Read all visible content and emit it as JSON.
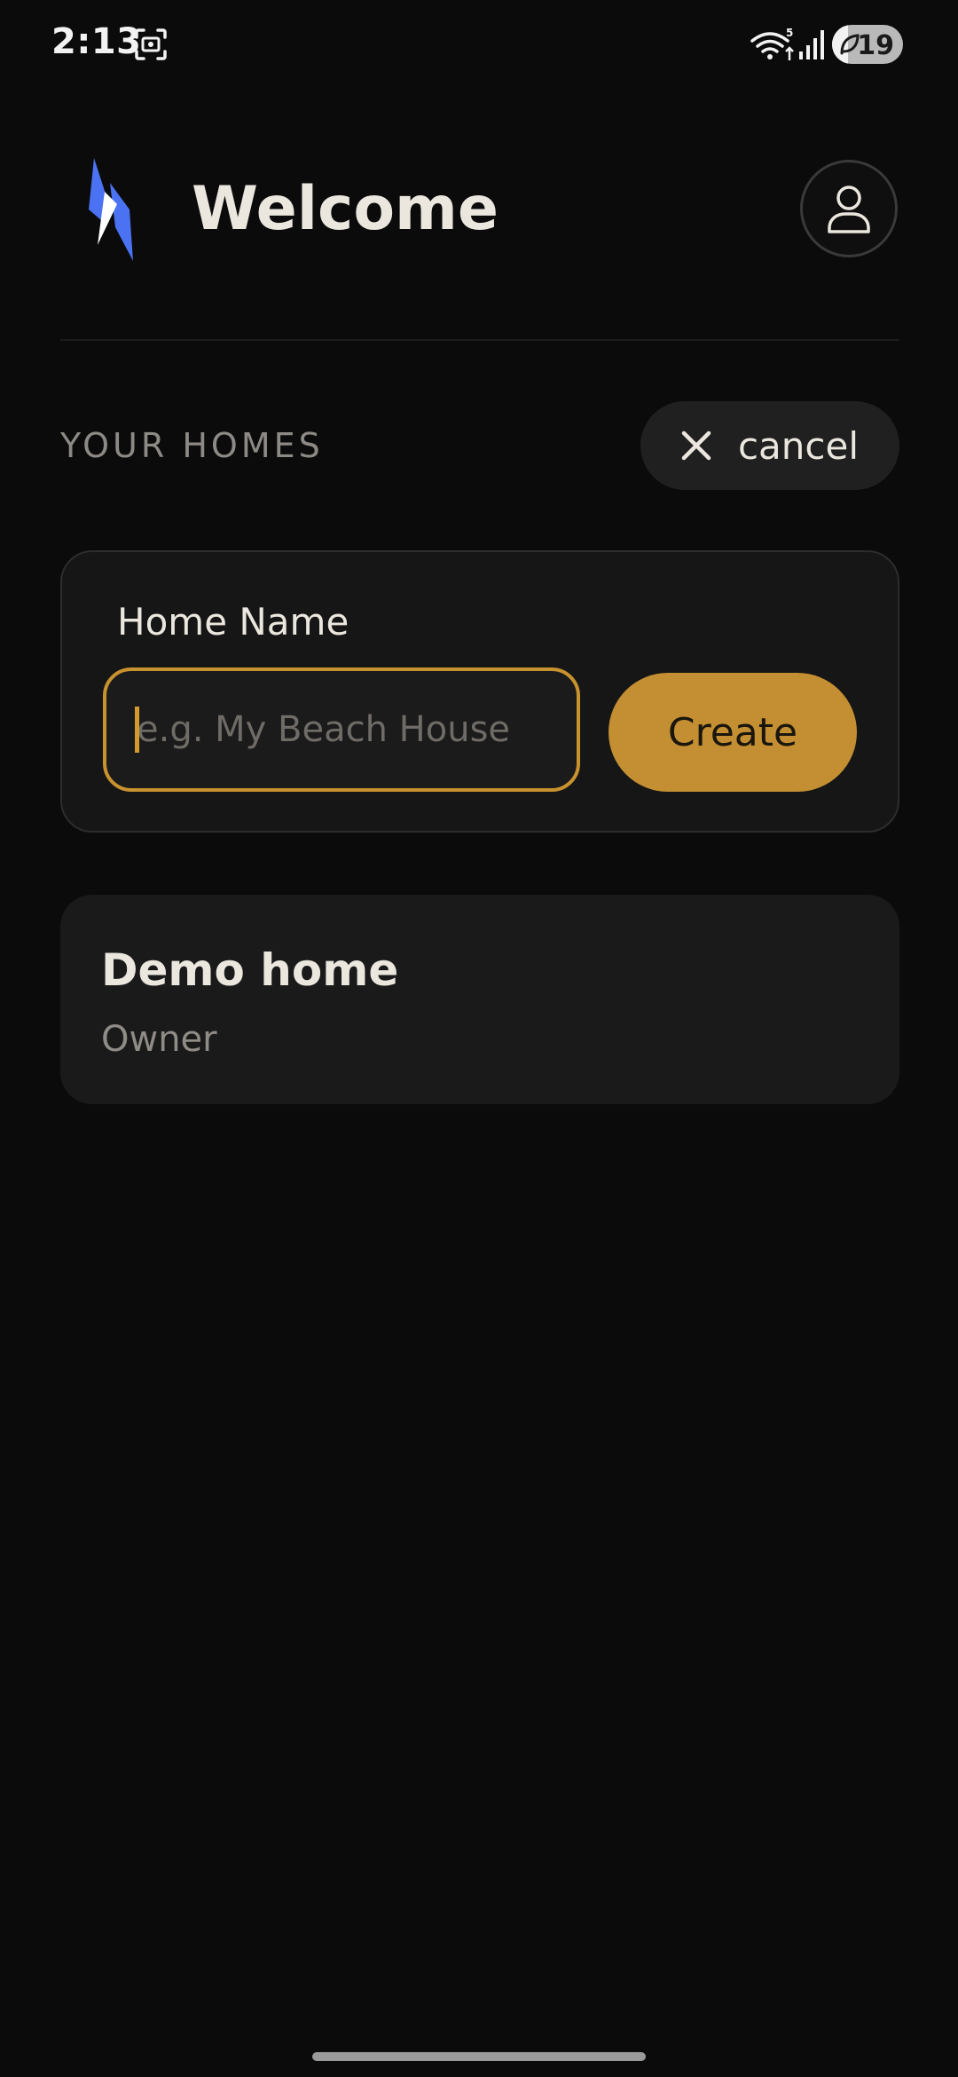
{
  "status_bar": {
    "time": "2:13",
    "battery": "19",
    "icons": [
      "screenshot-icon",
      "wifi-icon",
      "signal-icon",
      "battery-saver-icon"
    ]
  },
  "header": {
    "title": "Welcome",
    "logo_icon": "lightning-bolt-icon",
    "profile_icon": "person-icon"
  },
  "homes_section": {
    "title": "YOUR HOMES",
    "cancel_label": "cancel"
  },
  "create_form": {
    "label": "Home Name",
    "value": "",
    "placeholder": "e.g. My Beach House",
    "create_label": "Create"
  },
  "homes": [
    {
      "name": "Demo home",
      "role": "Owner"
    }
  ],
  "colors": {
    "background": "#0b0b0b",
    "accent": "#c48f32",
    "card": "#1a1a1a",
    "logo_blue": "#4a72f2"
  }
}
